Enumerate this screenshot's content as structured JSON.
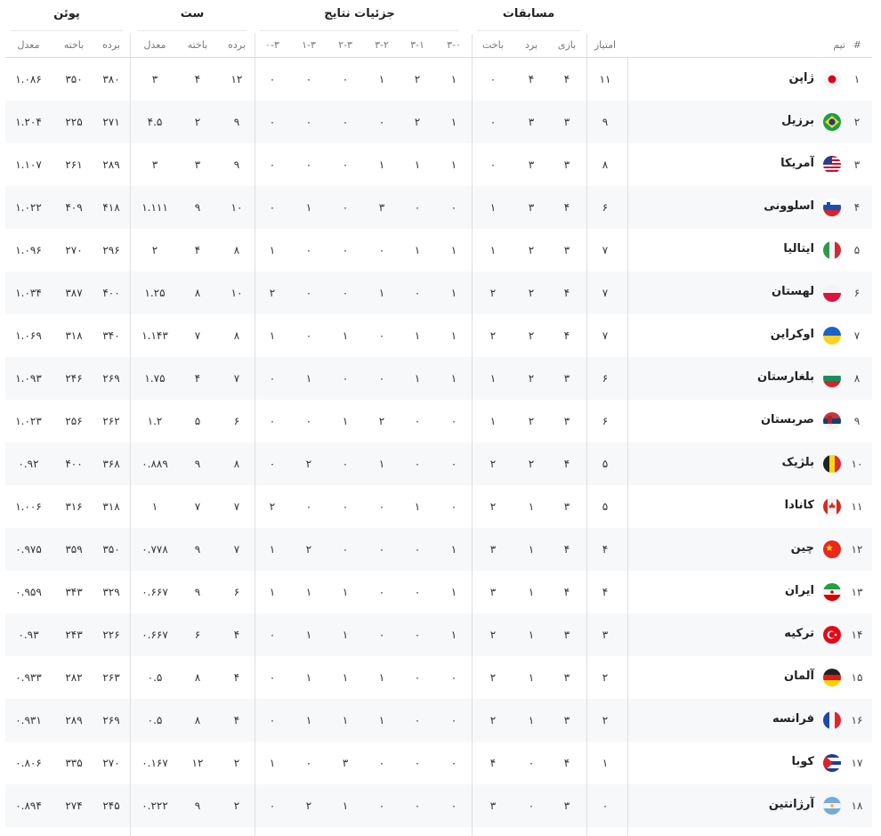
{
  "header": {
    "groups": {
      "matches": "مسابقات",
      "results": "جزئیات نتایج",
      "sets": "ست",
      "points": "پوئن"
    },
    "columns": {
      "rank": "#",
      "team": "تیم",
      "score": "امتیاز",
      "played": "بازی",
      "won": "برد",
      "lost": "باخت",
      "r30": "۳-۰",
      "r31": "۳-۱",
      "r32": "۳-۲",
      "r23": "۲-۳",
      "r13": "۱-۳",
      "r03": "۰-۳",
      "sets_won": "برده",
      "sets_lost": "باخته",
      "sets_ratio": "معدل",
      "points_won": "برده",
      "points_lost": "باخته",
      "points_ratio": "معدل"
    }
  },
  "rows": [
    {
      "rank": "۱",
      "team": "ژاپن",
      "flag": "japan-flag-icon",
      "score": "۱۱",
      "played": "۴",
      "won": "۴",
      "lost": "۰",
      "r30": "۱",
      "r31": "۲",
      "r32": "۱",
      "r23": "۰",
      "r13": "۰",
      "r03": "۰",
      "sets_won": "۱۲",
      "sets_lost": "۴",
      "sets_ratio": "۳",
      "points_won": "۳۸۰",
      "points_lost": "۳۵۰",
      "points_ratio": "۱.۰۸۶"
    },
    {
      "rank": "۲",
      "team": "برزیل",
      "flag": "brazil-flag-icon",
      "score": "۹",
      "played": "۳",
      "won": "۳",
      "lost": "۰",
      "r30": "۱",
      "r31": "۲",
      "r32": "۰",
      "r23": "۰",
      "r13": "۰",
      "r03": "۰",
      "sets_won": "۹",
      "sets_lost": "۲",
      "sets_ratio": "۴.۵",
      "points_won": "۲۷۱",
      "points_lost": "۲۲۵",
      "points_ratio": "۱.۲۰۴"
    },
    {
      "rank": "۳",
      "team": "آمریکا",
      "flag": "usa-flag-icon",
      "score": "۸",
      "played": "۳",
      "won": "۳",
      "lost": "۰",
      "r30": "۱",
      "r31": "۱",
      "r32": "۱",
      "r23": "۰",
      "r13": "۰",
      "r03": "۰",
      "sets_won": "۹",
      "sets_lost": "۳",
      "sets_ratio": "۳",
      "points_won": "۲۸۹",
      "points_lost": "۲۶۱",
      "points_ratio": "۱.۱۰۷"
    },
    {
      "rank": "۴",
      "team": "اسلوونی",
      "flag": "slovenia-flag-icon",
      "score": "۶",
      "played": "۴",
      "won": "۳",
      "lost": "۱",
      "r30": "۰",
      "r31": "۰",
      "r32": "۳",
      "r23": "۰",
      "r13": "۱",
      "r03": "۰",
      "sets_won": "۱۰",
      "sets_lost": "۹",
      "sets_ratio": "۱.۱۱۱",
      "points_won": "۴۱۸",
      "points_lost": "۴۰۹",
      "points_ratio": "۱.۰۲۲"
    },
    {
      "rank": "۵",
      "team": "ایتالیا",
      "flag": "italy-flag-icon",
      "score": "۷",
      "played": "۳",
      "won": "۲",
      "lost": "۱",
      "r30": "۱",
      "r31": "۱",
      "r32": "۰",
      "r23": "۰",
      "r13": "۰",
      "r03": "۱",
      "sets_won": "۸",
      "sets_lost": "۴",
      "sets_ratio": "۲",
      "points_won": "۲۹۶",
      "points_lost": "۲۷۰",
      "points_ratio": "۱.۰۹۶"
    },
    {
      "rank": "۶",
      "team": "لهستان",
      "flag": "poland-flag-icon",
      "score": "۷",
      "played": "۴",
      "won": "۲",
      "lost": "۲",
      "r30": "۱",
      "r31": "۰",
      "r32": "۱",
      "r23": "۰",
      "r13": "۰",
      "r03": "۲",
      "sets_won": "۱۰",
      "sets_lost": "۸",
      "sets_ratio": "۱.۲۵",
      "points_won": "۴۰۰",
      "points_lost": "۳۸۷",
      "points_ratio": "۱.۰۳۴"
    },
    {
      "rank": "۷",
      "team": "اوکراین",
      "flag": "ukraine-flag-icon",
      "score": "۷",
      "played": "۴",
      "won": "۲",
      "lost": "۲",
      "r30": "۱",
      "r31": "۱",
      "r32": "۰",
      "r23": "۱",
      "r13": "۰",
      "r03": "۱",
      "sets_won": "۸",
      "sets_lost": "۷",
      "sets_ratio": "۱.۱۴۳",
      "points_won": "۳۴۰",
      "points_lost": "۳۱۸",
      "points_ratio": "۱.۰۶۹"
    },
    {
      "rank": "۸",
      "team": "بلغارستان",
      "flag": "bulgaria-flag-icon",
      "score": "۶",
      "played": "۳",
      "won": "۲",
      "lost": "۱",
      "r30": "۱",
      "r31": "۱",
      "r32": "۰",
      "r23": "۰",
      "r13": "۱",
      "r03": "۰",
      "sets_won": "۷",
      "sets_lost": "۴",
      "sets_ratio": "۱.۷۵",
      "points_won": "۲۶۹",
      "points_lost": "۲۴۶",
      "points_ratio": "۱.۰۹۳"
    },
    {
      "rank": "۹",
      "team": "صربستان",
      "flag": "serbia-flag-icon",
      "score": "۶",
      "played": "۳",
      "won": "۲",
      "lost": "۱",
      "r30": "۰",
      "r31": "۰",
      "r32": "۲",
      "r23": "۱",
      "r13": "۰",
      "r03": "۰",
      "sets_won": "۶",
      "sets_lost": "۵",
      "sets_ratio": "۱.۲",
      "points_won": "۲۶۲",
      "points_lost": "۲۵۶",
      "points_ratio": "۱.۰۲۳"
    },
    {
      "rank": "۱۰",
      "team": "بلژیک",
      "flag": "belgium-flag-icon",
      "score": "۵",
      "played": "۴",
      "won": "۲",
      "lost": "۲",
      "r30": "۰",
      "r31": "۰",
      "r32": "۱",
      "r23": "۰",
      "r13": "۲",
      "r03": "۰",
      "sets_won": "۸",
      "sets_lost": "۹",
      "sets_ratio": "۰.۸۸۹",
      "points_won": "۳۶۸",
      "points_lost": "۴۰۰",
      "points_ratio": "۰.۹۲"
    },
    {
      "rank": "۱۱",
      "team": "کانادا",
      "flag": "canada-flag-icon",
      "score": "۵",
      "played": "۳",
      "won": "۱",
      "lost": "۲",
      "r30": "۰",
      "r31": "۱",
      "r32": "۰",
      "r23": "۰",
      "r13": "۰",
      "r03": "۲",
      "sets_won": "۷",
      "sets_lost": "۷",
      "sets_ratio": "۱",
      "points_won": "۳۱۸",
      "points_lost": "۳۱۶",
      "points_ratio": "۱.۰۰۶"
    },
    {
      "rank": "۱۲",
      "team": "چین",
      "flag": "china-flag-icon",
      "score": "۴",
      "played": "۴",
      "won": "۱",
      "lost": "۳",
      "r30": "۱",
      "r31": "۰",
      "r32": "۰",
      "r23": "۰",
      "r13": "۲",
      "r03": "۱",
      "sets_won": "۷",
      "sets_lost": "۹",
      "sets_ratio": "۰.۷۷۸",
      "points_won": "۳۵۰",
      "points_lost": "۳۵۹",
      "points_ratio": "۰.۹۷۵"
    },
    {
      "rank": "۱۳",
      "team": "ایران",
      "flag": "iran-flag-icon",
      "score": "۴",
      "played": "۴",
      "won": "۱",
      "lost": "۳",
      "r30": "۱",
      "r31": "۰",
      "r32": "۰",
      "r23": "۱",
      "r13": "۱",
      "r03": "۱",
      "sets_won": "۶",
      "sets_lost": "۹",
      "sets_ratio": "۰.۶۶۷",
      "points_won": "۳۲۹",
      "points_lost": "۳۴۳",
      "points_ratio": "۰.۹۵۹"
    },
    {
      "rank": "۱۴",
      "team": "ترکیه",
      "flag": "turkey-flag-icon",
      "score": "۳",
      "played": "۳",
      "won": "۱",
      "lost": "۲",
      "r30": "۱",
      "r31": "۰",
      "r32": "۰",
      "r23": "۱",
      "r13": "۱",
      "r03": "۰",
      "sets_won": "۴",
      "sets_lost": "۶",
      "sets_ratio": "۰.۶۶۷",
      "points_won": "۲۲۶",
      "points_lost": "۲۴۳",
      "points_ratio": "۰.۹۳"
    },
    {
      "rank": "۱۵",
      "team": "آلمان",
      "flag": "germany-flag-icon",
      "score": "۲",
      "played": "۳",
      "won": "۱",
      "lost": "۲",
      "r30": "۰",
      "r31": "۰",
      "r32": "۱",
      "r23": "۱",
      "r13": "۱",
      "r03": "۰",
      "sets_won": "۴",
      "sets_lost": "۸",
      "sets_ratio": "۰.۵",
      "points_won": "۲۶۳",
      "points_lost": "۲۸۲",
      "points_ratio": "۰.۹۳۳"
    },
    {
      "rank": "۱۶",
      "team": "فرانسه",
      "flag": "france-flag-icon",
      "score": "۲",
      "played": "۳",
      "won": "۱",
      "lost": "۲",
      "r30": "۰",
      "r31": "۰",
      "r32": "۱",
      "r23": "۱",
      "r13": "۱",
      "r03": "۰",
      "sets_won": "۴",
      "sets_lost": "۸",
      "sets_ratio": "۰.۵",
      "points_won": "۲۶۹",
      "points_lost": "۲۸۹",
      "points_ratio": "۰.۹۳۱"
    },
    {
      "rank": "۱۷",
      "team": "کوبا",
      "flag": "cuba-flag-icon",
      "score": "۱",
      "played": "۴",
      "won": "۰",
      "lost": "۴",
      "r30": "۰",
      "r31": "۰",
      "r32": "۰",
      "r23": "۳",
      "r13": "۰",
      "r03": "۱",
      "sets_won": "۲",
      "sets_lost": "۱۲",
      "sets_ratio": "۰.۱۶۷",
      "points_won": "۲۷۰",
      "points_lost": "۳۳۵",
      "points_ratio": "۰.۸۰۶"
    },
    {
      "rank": "۱۸",
      "team": "آرژانتین",
      "flag": "argentina-flag-icon",
      "score": "۰",
      "played": "۳",
      "won": "۰",
      "lost": "۳",
      "r30": "۰",
      "r31": "۰",
      "r32": "۰",
      "r23": "۱",
      "r13": "۲",
      "r03": "۰",
      "sets_won": "۲",
      "sets_lost": "۹",
      "sets_ratio": "۰.۲۲۲",
      "points_won": "۲۴۵",
      "points_lost": "۲۷۴",
      "points_ratio": "۰.۸۹۴"
    }
  ]
}
